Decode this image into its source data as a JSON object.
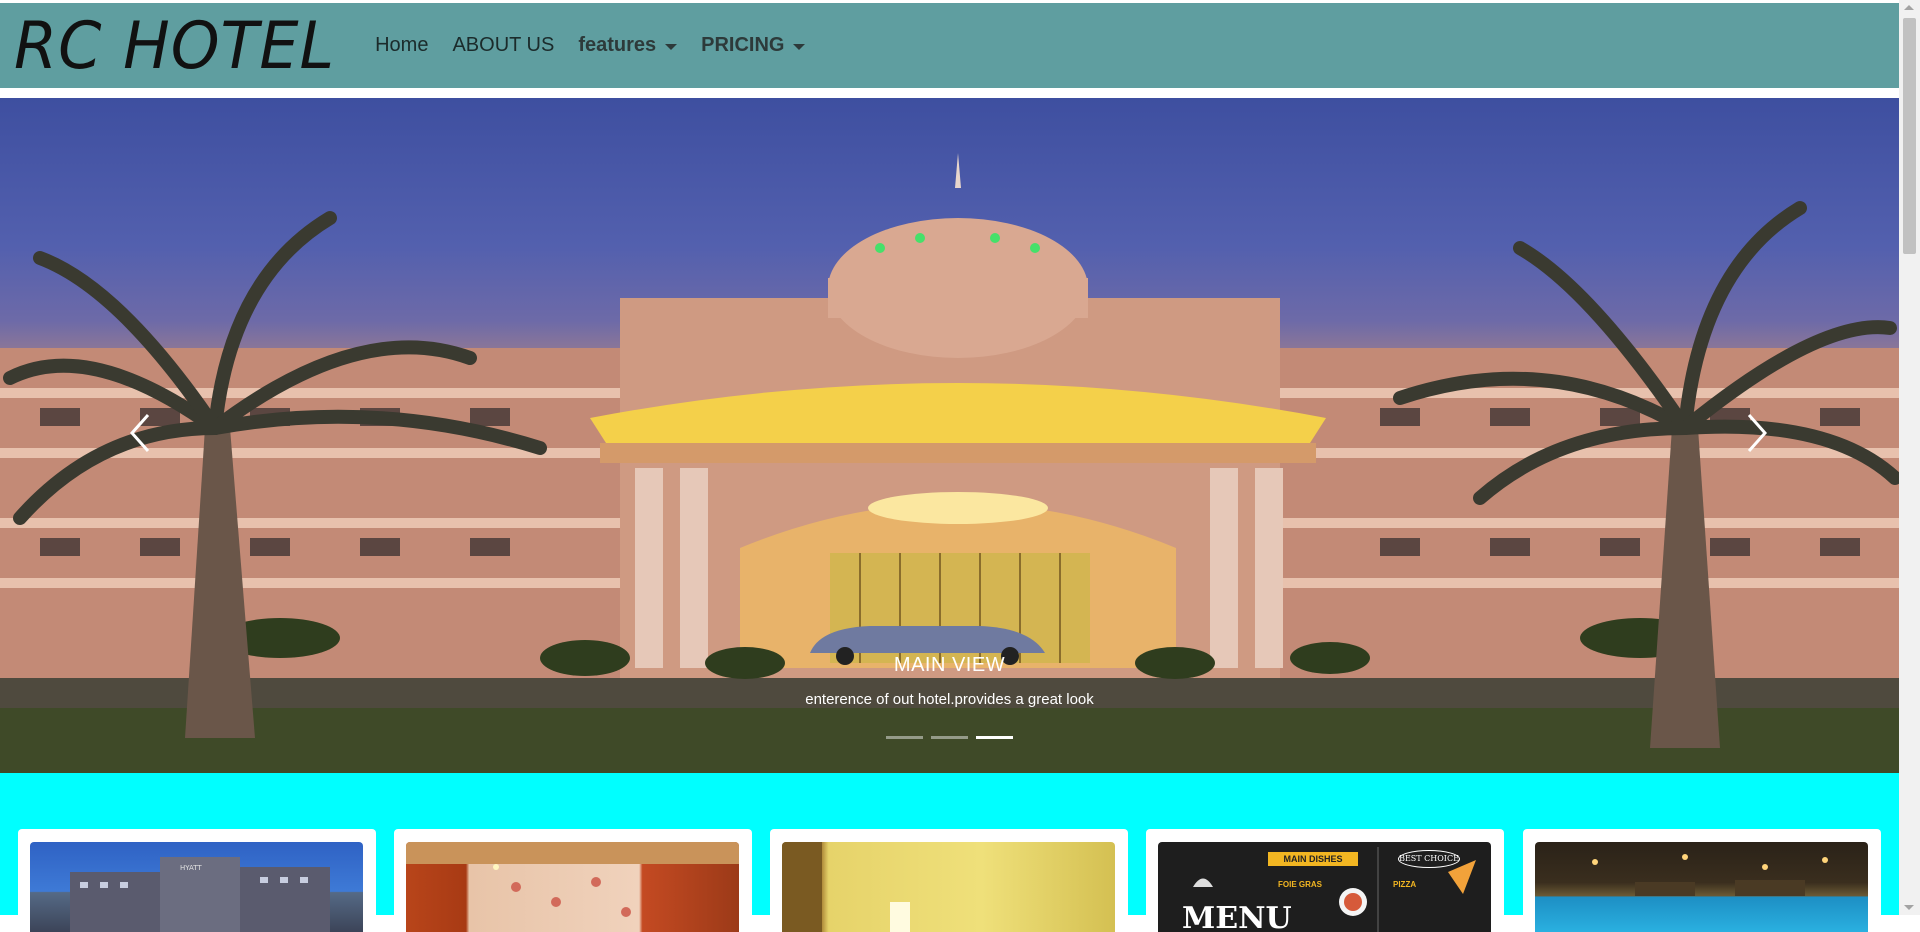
{
  "navbar": {
    "brand": "RC HOTEL",
    "items": [
      {
        "label": "Home",
        "dropdown": false
      },
      {
        "label": "ABOUT US",
        "dropdown": false
      },
      {
        "label": "features",
        "dropdown": true
      },
      {
        "label": "PRICING",
        "dropdown": true
      }
    ],
    "background": "#5f9ea0"
  },
  "carousel": {
    "caption_title": "MAIN VIEW",
    "caption_text": "enterence of out hotel.provides a great look",
    "prev_icon": "chevron-left-icon",
    "next_icon": "chevron-right-icon",
    "indicator_count": 3,
    "active_indicator": 3
  },
  "cards": {
    "background": "#00ffff",
    "items": [
      {
        "image": "hotel-exterior-photo",
        "sign": "HYATT"
      },
      {
        "image": "room-interior-photo"
      },
      {
        "image": "bedroom-photo"
      },
      {
        "image": "menu-photo",
        "menu_title": "MENU",
        "menu_tag": "MAIN DISHES",
        "menu_badge": "BEST CHOICE",
        "menu_item_1": "FOIE GRAS",
        "menu_item_2": "PIZZA"
      },
      {
        "image": "pool-night-photo"
      }
    ]
  }
}
